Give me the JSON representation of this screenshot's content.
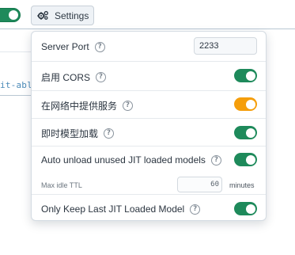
{
  "toolbar": {
    "settings_label": "Settings",
    "code_snippet": "it-abl"
  },
  "settings": {
    "server_port": {
      "label": "Server Port",
      "value": "2233"
    },
    "cors": {
      "label": "启用 CORS",
      "enabled": true
    },
    "network": {
      "label": "在网络中提供服务",
      "enabled": true,
      "state_color": "#f59e0b"
    },
    "jit_load": {
      "label": "即时模型加载",
      "enabled": true
    },
    "auto_unload": {
      "label": "Auto unload unused JIT loaded models",
      "enabled": true,
      "ttl_label": "Max idle TTL",
      "ttl_value": "60",
      "ttl_unit": "minutes"
    },
    "keep_last": {
      "label": "Only Keep Last JIT Loaded Model",
      "enabled": true
    }
  },
  "colors": {
    "toggle_on": "#1e8a5b",
    "toggle_warn": "#f59e0b"
  },
  "icons": {
    "help": "question-circle-icon",
    "settings": "gears-icon"
  }
}
